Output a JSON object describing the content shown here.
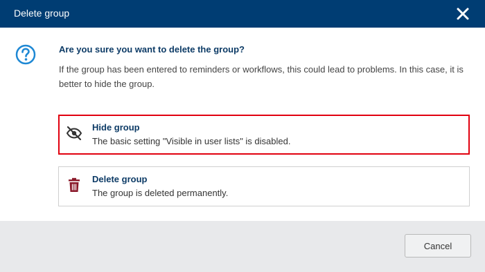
{
  "dialog": {
    "title": "Delete group",
    "question": "Are you sure you want to delete the group?",
    "description": "If the group has been entered to reminders or workflows, this could lead to problems. In this case, it is better to hide the group.",
    "colors": {
      "header": "#003d73",
      "highlight": "#e1000f",
      "accent": "#1e88d4",
      "trash": "#8b1a2b"
    }
  },
  "options": [
    {
      "title": "Hide group",
      "text": "The basic setting \"Visible in user lists\" is disabled.",
      "icon": "eye-slash-icon"
    },
    {
      "title": "Delete group",
      "text": "The group is deleted permanently.",
      "icon": "trash-icon"
    }
  ],
  "footer": {
    "cancel_label": "Cancel"
  }
}
